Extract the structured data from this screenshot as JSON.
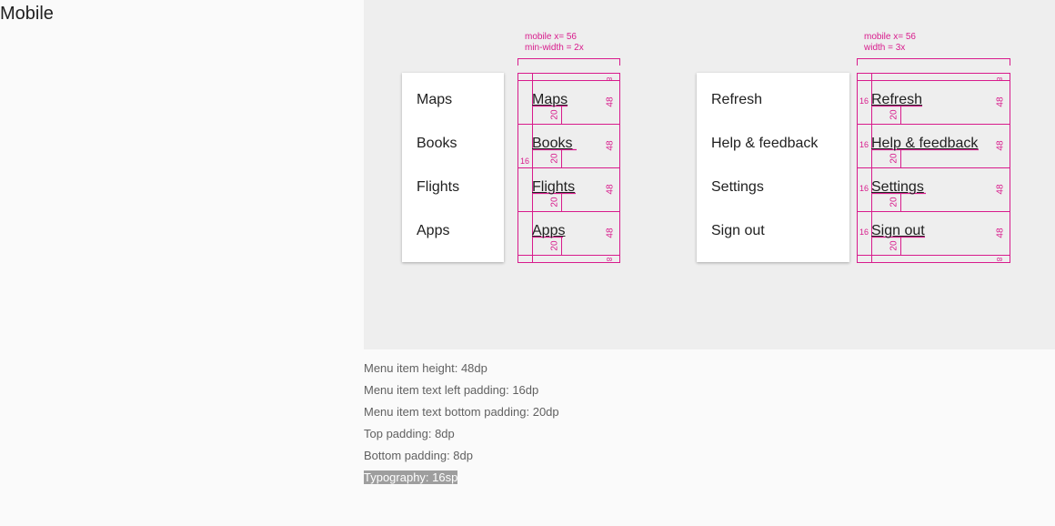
{
  "page": {
    "title": "Mobile"
  },
  "colors": {
    "spec": "#d81b8c",
    "stage": "#eeeeee",
    "menu_bg": "#ffffff"
  },
  "left_spec": {
    "annotation_line1": "mobile x= 56",
    "annotation_line2": "min-width = 2x",
    "items": [
      "Maps",
      "Books",
      "Flights",
      "Apps"
    ],
    "height_label": "48",
    "bottom_label": "20",
    "padding_label": "8",
    "left_label": "16"
  },
  "right_spec": {
    "annotation_line1": "mobile x= 56",
    "annotation_line2": "width = 3x",
    "items": [
      "Refresh",
      "Help & feedback",
      "Settings",
      "Sign out"
    ],
    "height_label": "48",
    "bottom_label": "20",
    "padding_label": "8",
    "left_label": "16"
  },
  "left_menu": {
    "items": [
      "Maps",
      "Books",
      "Flights",
      "Apps"
    ]
  },
  "right_menu": {
    "items": [
      "Refresh",
      "Help & feedback",
      "Settings",
      "Sign out"
    ]
  },
  "notes": [
    "Menu item height: 48dp",
    "Menu item text left padding: 16dp",
    "Menu item text bottom padding: 20dp",
    "Top padding: 8dp",
    "Bottom padding: 8dp",
    "Typography: 16sp"
  ]
}
